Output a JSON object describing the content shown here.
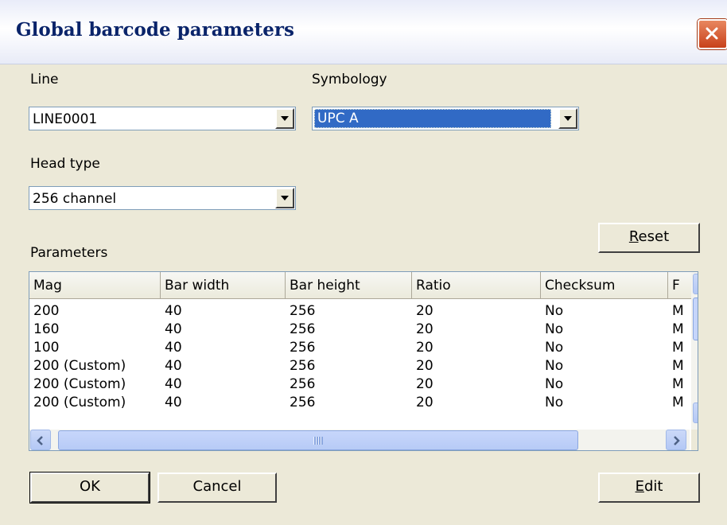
{
  "window": {
    "title": "Global barcode parameters"
  },
  "line": {
    "label": "Line",
    "value": "LINE0001"
  },
  "symbology": {
    "label": "Symbology",
    "value": "UPC A"
  },
  "head_type": {
    "label": "Head type",
    "value": "256 channel"
  },
  "parameters": {
    "label": "Parameters",
    "columns": [
      "Mag",
      "Bar width",
      "Bar height",
      "Ratio",
      "Checksum",
      "F"
    ],
    "rows": [
      [
        "200",
        "40",
        "256",
        "20",
        "No",
        "M"
      ],
      [
        "160",
        "40",
        "256",
        "20",
        "No",
        "M"
      ],
      [
        "100",
        "40",
        "256",
        "20",
        "No",
        "M"
      ],
      [
        "200 (Custom)",
        "40",
        "256",
        "20",
        "No",
        "M"
      ],
      [
        "200 (Custom)",
        "40",
        "256",
        "20",
        "No",
        "M"
      ],
      [
        "200 (Custom)",
        "40",
        "256",
        "20",
        "No",
        "M"
      ]
    ]
  },
  "buttons": {
    "reset": "Reset",
    "ok": "OK",
    "cancel": "Cancel",
    "edit": "Edit"
  },
  "icons": {
    "close": "close-icon",
    "dropdown": "chevron-down-icon",
    "scroll_up": "chevron-up-icon",
    "scroll_down": "chevron-down-icon",
    "scroll_left": "chevron-left-icon",
    "scroll_right": "chevron-right-icon"
  },
  "colors": {
    "title_text": "#0a246a",
    "close_button": "#d9572a",
    "selection": "#316ac5",
    "dialog_bg": "#ece9d8"
  }
}
